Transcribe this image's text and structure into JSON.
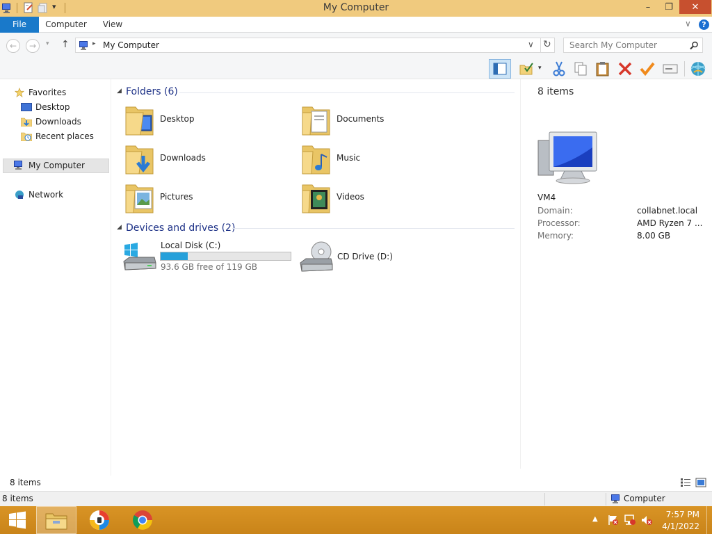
{
  "window": {
    "title": "My Computer",
    "min_glyph": "–",
    "max_glyph": "❐",
    "close_glyph": "✕"
  },
  "ribbon": {
    "tabs": [
      "File",
      "Computer",
      "View"
    ],
    "expand_glyph": "∨",
    "help_glyph": "?"
  },
  "address": {
    "path": "My Computer",
    "search_placeholder": "Search My Computer"
  },
  "nav": {
    "favorites": "Favorites",
    "favorites_items": [
      "Desktop",
      "Downloads",
      "Recent places"
    ],
    "computer": "My Computer",
    "network": "Network"
  },
  "content": {
    "folders_header": "Folders (6)",
    "folders": [
      "Desktop",
      "Documents",
      "Downloads",
      "Music",
      "Pictures",
      "Videos"
    ],
    "devices_header": "Devices and drives (2)",
    "drives": [
      {
        "name": "Local Disk (C:)",
        "free_text": "93.6 GB free of 119 GB",
        "used_fraction": 0.21
      },
      {
        "name": "CD Drive (D:)"
      }
    ]
  },
  "details": {
    "count": "8 items",
    "name": "VM4",
    "rows": [
      {
        "label": "Domain:",
        "value": "collabnet.local"
      },
      {
        "label": "Processor:",
        "value": "AMD Ryzen 7 ..."
      },
      {
        "label": "Memory:",
        "value": "8.00 GB"
      }
    ]
  },
  "status": {
    "items": "8 items",
    "items2": "8 items",
    "zone": "Computer"
  },
  "taskbar": {
    "time": "7:57 PM",
    "date": "4/1/2022"
  },
  "colors": {
    "titlebar": "#f0ca7e",
    "file_tab": "#1979ca",
    "close": "#c7502f",
    "group_header": "#1e3287",
    "taskbar": "#d08a1f",
    "drive_bar": "#26a0da"
  }
}
